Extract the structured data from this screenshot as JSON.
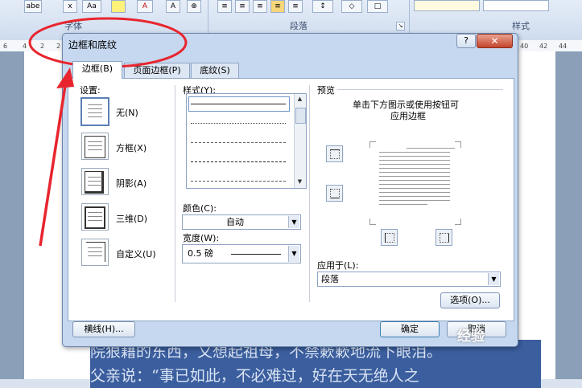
{
  "ribbon": {
    "groups": [
      "字体",
      "段落",
      "样式"
    ],
    "top_items": [
      "abe",
      "x",
      "Aa",
      "A"
    ]
  },
  "ruler": [
    "6",
    "4",
    "2",
    "2",
    "40",
    "42",
    "44"
  ],
  "document": {
    "lines": [
      "院狠藉的东西，又想起祖母，不禁簌簌地流下眼泪。",
      "父亲说：“事已如此，不必难过，好在天无绝人之"
    ]
  },
  "dialog": {
    "title": "边框和底纹",
    "help": "?",
    "close": "✕",
    "tabs": [
      "边框(B)",
      "页面边框(P)",
      "底纹(S)"
    ],
    "setting_label": "设置:",
    "settings": [
      "无(N)",
      "方框(X)",
      "阴影(A)",
      "三维(D)",
      "自定义(U)"
    ],
    "style_label": "样式(Y):",
    "color_label": "颜色(C):",
    "color_value": "自动",
    "width_label": "宽度(W):",
    "width_value": "0.5 磅",
    "preview_label": "预览",
    "preview_hint_1": "单击下方图示或使用按钮可",
    "preview_hint_2": "应用边框",
    "apply_label": "应用于(L):",
    "apply_value": "段落",
    "options_button": "选项(O)...",
    "hline_button": "横线(H)...",
    "ok_button": "确定",
    "cancel_button": "取消"
  },
  "watermark": "经验",
  "colors": {
    "annotation": "#e8252e",
    "dialog_bg": "#c6d8ef",
    "selection": "#3b5e9e"
  }
}
